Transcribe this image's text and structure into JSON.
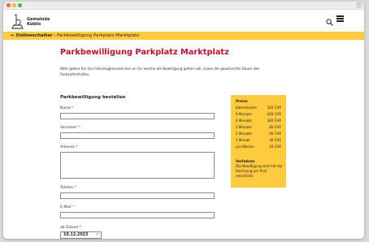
{
  "logo": {
    "line1": "Gemeinde",
    "line2": "Küblis"
  },
  "icons": {
    "search": "search-icon",
    "menu": "menu-icon",
    "back": "arrow-left-icon"
  },
  "breadcrumb": {
    "back_label": "← Onlineschalter",
    "separator": "›",
    "current": "Parkbewilligung Parkplatz Marktplatz"
  },
  "page": {
    "title": "Parkbewilligung Parkplatz Marktplatz",
    "intro": "Bitte geben Sie das Fahrzeugkennzeichen an für welche die Bewilligung gelten soll, sowie die gewünschte Dauer des Parkaufenthaltes."
  },
  "form": {
    "section_title": "Parkbewilligung bestellen",
    "required_mark": "*",
    "fields": {
      "name": {
        "label": "Name",
        "value": ""
      },
      "vorname": {
        "label": "Vorname",
        "value": ""
      },
      "adresse": {
        "label": "Adresse",
        "value": ""
      },
      "telefon": {
        "label": "Telefon",
        "value": ""
      },
      "email": {
        "label": "E-Mail",
        "value": ""
      },
      "datum": {
        "label": "ab Datum",
        "value": "10.12.2023",
        "clear": "×"
      }
    }
  },
  "prices": {
    "title": "Preise",
    "rows": [
      {
        "label": "Kalenderjahr:",
        "value": "320 CHF"
      },
      {
        "label": "9 Monate:",
        "value": "240 CHF"
      },
      {
        "label": "6 Monate:",
        "value": "160 CHF"
      },
      {
        "label": "3 Monate:",
        "value": "80 CHF"
      },
      {
        "label": "2 Monate:",
        "value": "60 CHF"
      },
      {
        "label": "1 Monat:",
        "value": "30 CHF"
      },
      {
        "label": "pro Woche:",
        "value": "10 CHF"
      }
    ],
    "procedure_title": "Verfahren",
    "procedure_text": "Die Bewilligung wird mit der Rechnung per Post verschickt."
  },
  "colors": {
    "accent_red": "#c8102e",
    "accent_yellow": "#fecb3e"
  }
}
